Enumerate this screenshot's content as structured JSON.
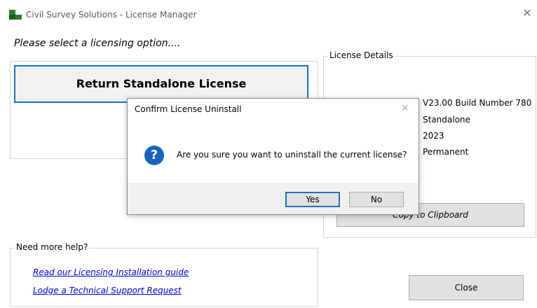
{
  "window": {
    "title": "Civil Survey Solutions - License Manager",
    "close_glyph": "✕",
    "icon": "app-logo-icon"
  },
  "prompt": "Please select a licensing option....",
  "return_button": "Return Standalone License",
  "license_details": {
    "legend": "License Details",
    "values": [
      "V23.00 Build Number 780",
      "Standalone",
      "2023",
      "Permanent"
    ],
    "copy_button": "Copy to Clipboard"
  },
  "help": {
    "legend": "Need more help?",
    "links": [
      "Read our Licensing Installation guide",
      "Lodge a Technical Support Request"
    ]
  },
  "close_button": "Close",
  "dialog": {
    "title": "Confirm License Uninstall",
    "close_glyph": "✕",
    "icon": "question-icon",
    "message": "Are you sure you want to uninstall the current license?",
    "yes": "Yes",
    "no": "No"
  },
  "colors": {
    "accent": "#1e73be",
    "link": "#0000ee",
    "question_icon": "#1565c0"
  }
}
